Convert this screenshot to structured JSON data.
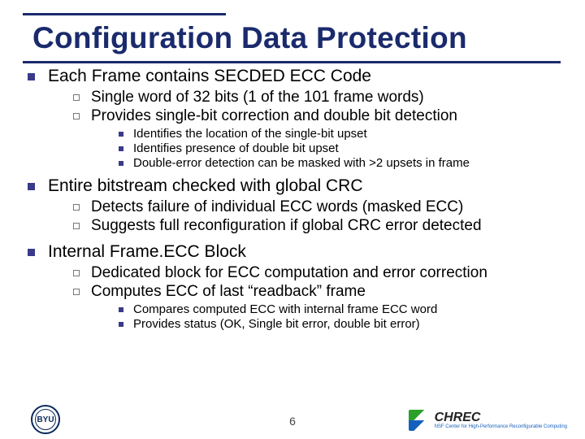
{
  "title": "Configuration Data Protection",
  "page_number": "6",
  "sections": [
    {
      "heading": "Each Frame contains SECDED ECC Code",
      "subs": [
        {
          "text": "Single word of 32 bits (1 of the 101 frame words)"
        },
        {
          "text": "Provides single-bit correction and double bit detection",
          "subsubs": [
            "Identifies the location of the single-bit upset",
            "Identifies presence of double bit upset",
            "Double-error detection can be masked with >2 upsets in frame"
          ]
        }
      ]
    },
    {
      "heading": "Entire bitstream checked with global CRC",
      "subs": [
        {
          "text": "Detects failure of individual ECC words (masked ECC)"
        },
        {
          "text": "Suggests full reconfiguration if global CRC error detected"
        }
      ]
    },
    {
      "heading": "Internal Frame.ECC Block",
      "subs": [
        {
          "text": "Dedicated block for ECC computation and error correction"
        },
        {
          "text": "Computes ECC of last “readback” frame",
          "subsubs": [
            "Compares computed ECC with internal frame ECC word",
            "Provides status (OK, Single bit error, double bit error)"
          ]
        }
      ]
    }
  ],
  "logos": {
    "byu": "BYU",
    "chrec": "CHREC",
    "chrec_sub": "NSF Center for High-Performance Reconfigurable Computing"
  }
}
